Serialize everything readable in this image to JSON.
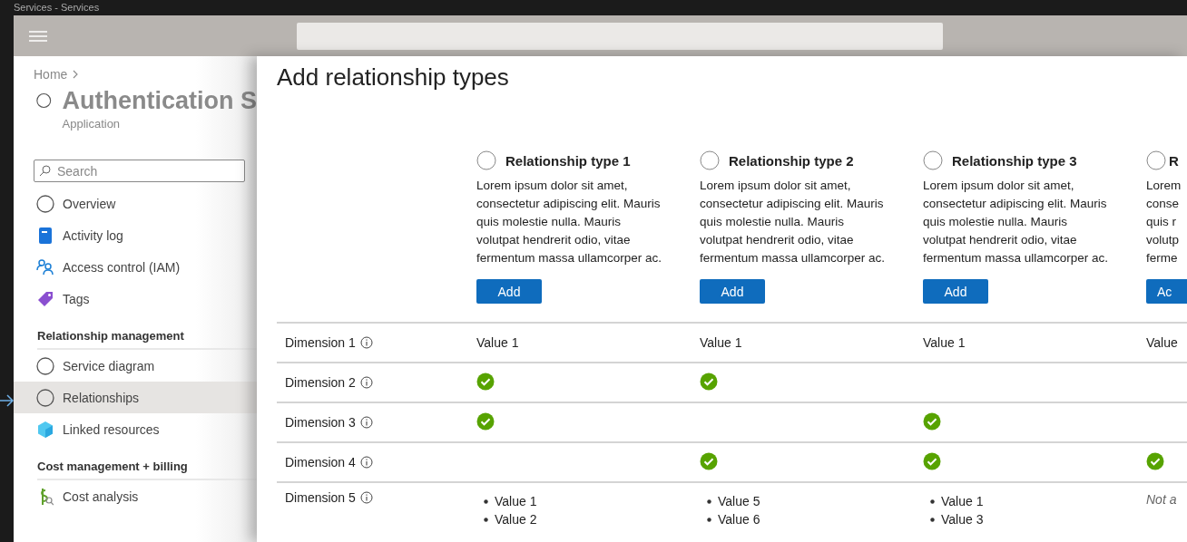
{
  "window": {
    "title": "Services - Services"
  },
  "sidebar": {
    "breadcrumb": "Home",
    "resource": {
      "name": "Authentication S",
      "type": "Application"
    },
    "search": {
      "placeholder": "Search"
    },
    "groups": [
      {
        "items": [
          {
            "label": "Overview",
            "selected": false
          },
          {
            "label": "Activity log",
            "selected": false
          },
          {
            "label": "Access control (IAM)",
            "selected": false
          },
          {
            "label": "Tags",
            "selected": false
          }
        ]
      },
      {
        "heading": "Relationship management",
        "items": [
          {
            "label": "Service diagram",
            "selected": false
          },
          {
            "label": "Relationships",
            "selected": true
          },
          {
            "label": "Linked resources",
            "selected": false
          }
        ]
      },
      {
        "heading": "Cost management + billing",
        "items": [
          {
            "label": "Cost analysis",
            "selected": false
          }
        ]
      }
    ]
  },
  "panel": {
    "title": "Add relationship types",
    "types": [
      {
        "name": "Relationship type 1",
        "selected": false,
        "description_lines": [
          "Lorem ipsum dolor sit amet,",
          "consectetur adipiscing elit. Mauris",
          "quis molestie nulla. Mauris",
          "volutpat hendrerit odio, vitae",
          "fermentum massa ullamcorper ac."
        ],
        "button": "Add"
      },
      {
        "name": "Relationship type 2",
        "selected": false,
        "description_lines": [
          "Lorem ipsum dolor sit amet,",
          "consectetur adipiscing elit. Mauris",
          "quis molestie nulla. Mauris",
          "volutpat hendrerit odio, vitae",
          "fermentum massa ullamcorper ac."
        ],
        "button": "Add"
      },
      {
        "name": "Relationship type 3",
        "selected": false,
        "description_lines": [
          "Lorem ipsum dolor sit amet,",
          "consectetur adipiscing elit. Mauris",
          "quis molestie nulla. Mauris",
          "volutpat hendrerit odio, vitae",
          "fermentum massa ullamcorper ac."
        ],
        "button": "Add"
      },
      {
        "name": "R",
        "selected": false,
        "description_lines": [
          "Lorem",
          "conse",
          "quis r",
          "volutp",
          "ferme"
        ],
        "button": "Ac"
      }
    ],
    "rows": [
      {
        "label": "Dimension 1",
        "cells": [
          {
            "kind": "text",
            "text": "Value 1"
          },
          {
            "kind": "text",
            "text": "Value 1"
          },
          {
            "kind": "text",
            "text": "Value 1"
          },
          {
            "kind": "text",
            "text": "Value"
          }
        ]
      },
      {
        "label": "Dimension 2",
        "cells": [
          {
            "kind": "check"
          },
          {
            "kind": "check"
          },
          {
            "kind": "empty"
          },
          {
            "kind": "empty"
          }
        ]
      },
      {
        "label": "Dimension 3",
        "cells": [
          {
            "kind": "check"
          },
          {
            "kind": "empty"
          },
          {
            "kind": "check"
          },
          {
            "kind": "empty"
          }
        ]
      },
      {
        "label": "Dimension 4",
        "cells": [
          {
            "kind": "empty"
          },
          {
            "kind": "check"
          },
          {
            "kind": "check"
          },
          {
            "kind": "check"
          }
        ]
      },
      {
        "label": "Dimension 5",
        "cells": [
          {
            "kind": "list",
            "items": [
              "Value 1",
              "Value 2"
            ]
          },
          {
            "kind": "list",
            "items": [
              "Value 5",
              "Value 6"
            ]
          },
          {
            "kind": "list",
            "items": [
              "Value 1",
              "Value 3"
            ]
          },
          {
            "kind": "note",
            "text": "Not a"
          }
        ]
      }
    ]
  }
}
